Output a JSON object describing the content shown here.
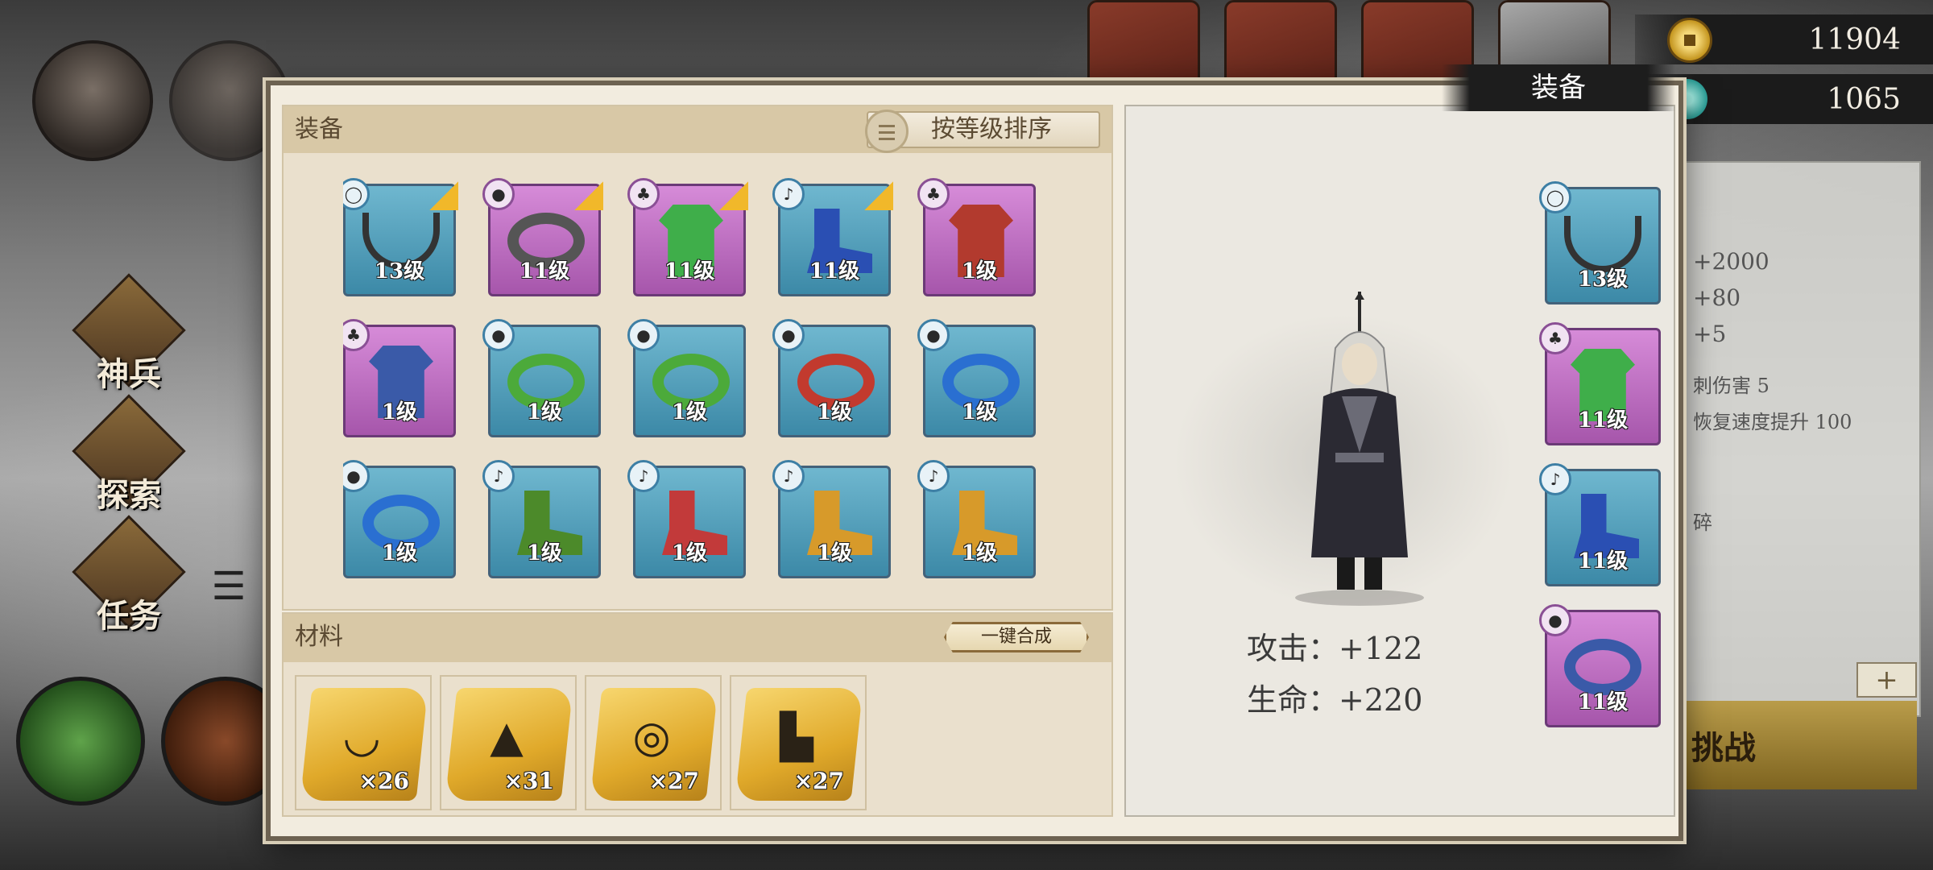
{
  "currency": {
    "coins": "11904",
    "gems": "1065"
  },
  "side_menu": [
    {
      "label": "神兵"
    },
    {
      "label": "探索"
    },
    {
      "label": "任务"
    }
  ],
  "bg_panel": {
    "lines": [
      "+2000",
      "+80",
      "+5",
      "刺伤害 5",
      "恢复速度提升 100",
      "碎"
    ]
  },
  "bg_challenge_label": "挑战",
  "bg_plus_label": "+",
  "dialog": {
    "tab_title": "装备",
    "equip_header": "装备",
    "sort_label": "按等级排序",
    "materials_header": "材料",
    "merge_label": "一键合成"
  },
  "grid_items": [
    {
      "type": "necklace",
      "level": "13级",
      "rarity": "blue",
      "badge": "necklace-icon",
      "new": true
    },
    {
      "type": "ring",
      "level": "11级",
      "rarity": "purple",
      "badge": "ring-icon",
      "new": true
    },
    {
      "type": "robe",
      "level": "11级",
      "rarity": "purple",
      "badge": "robe-icon",
      "new": true,
      "color": "#3fae4a"
    },
    {
      "type": "boots",
      "level": "11级",
      "rarity": "blue",
      "badge": "boots-icon",
      "new": true,
      "color": "#2a4fb3"
    },
    {
      "type": "robe",
      "level": "1级",
      "rarity": "purple",
      "badge": "robe-icon",
      "new": false,
      "color": "#b23a2e"
    },
    {
      "type": "robe",
      "level": "1级",
      "rarity": "purple",
      "badge": "robe-icon",
      "new": false,
      "color": "#3a5aa8"
    },
    {
      "type": "ring",
      "level": "1级",
      "rarity": "blue",
      "badge": "ring-icon",
      "new": false,
      "color": "#4caa3a"
    },
    {
      "type": "ring",
      "level": "1级",
      "rarity": "blue",
      "badge": "ring-icon",
      "new": false,
      "color": "#4caa3a"
    },
    {
      "type": "ring",
      "level": "1级",
      "rarity": "blue",
      "badge": "ring-icon",
      "new": false,
      "color": "#c23a2e"
    },
    {
      "type": "ring",
      "level": "1级",
      "rarity": "blue",
      "badge": "ring-icon",
      "new": false,
      "color": "#2a6fd1"
    },
    {
      "type": "ring",
      "level": "1级",
      "rarity": "blue",
      "badge": "ring-icon",
      "new": false,
      "color": "#2a6fd1"
    },
    {
      "type": "boots",
      "level": "1级",
      "rarity": "blue",
      "badge": "boots-icon",
      "new": false,
      "color": "#4c8a2a"
    },
    {
      "type": "boots",
      "level": "1级",
      "rarity": "blue",
      "badge": "boots-icon",
      "new": false,
      "color": "#c23a3a"
    },
    {
      "type": "boots",
      "level": "1级",
      "rarity": "blue",
      "badge": "boots-icon",
      "new": false,
      "color": "#d79a2a"
    },
    {
      "type": "boots",
      "level": "1级",
      "rarity": "blue",
      "badge": "boots-icon",
      "new": false,
      "color": "#d79a2a"
    },
    {
      "type": "necklace",
      "level": "",
      "rarity": "blue",
      "badge": "necklace-icon",
      "new": false
    },
    {
      "type": "boots",
      "level": "",
      "rarity": "blue",
      "badge": "boots-icon",
      "new": false
    },
    {
      "type": "boots",
      "level": "",
      "rarity": "blue",
      "badge": "boots-icon",
      "new": false
    },
    {
      "type": "necklace",
      "level": "",
      "rarity": "blue",
      "badge": "necklace-icon",
      "new": false
    },
    {
      "type": "ring",
      "level": "",
      "rarity": "blue",
      "badge": "ring-icon",
      "new": false
    }
  ],
  "materials": [
    {
      "icon": "necklace-scroll-icon",
      "qty": "×26"
    },
    {
      "icon": "robe-scroll-icon",
      "qty": "×31"
    },
    {
      "icon": "ring-scroll-icon",
      "qty": "×27"
    },
    {
      "icon": "boots-scroll-icon",
      "qty": "×27"
    }
  ],
  "character": {
    "attack": "攻击：+122",
    "hp": "生命：+220"
  },
  "equipped": [
    {
      "type": "necklace",
      "level": "13级",
      "rarity": "blue",
      "badge": "necklace-icon"
    },
    {
      "type": "robe",
      "level": "11级",
      "rarity": "purple",
      "badge": "robe-icon",
      "color": "#3fae4a"
    },
    {
      "type": "boots",
      "level": "11级",
      "rarity": "blue",
      "badge": "boots-icon",
      "color": "#2a4fb3"
    },
    {
      "type": "ring",
      "level": "11级",
      "rarity": "purple",
      "badge": "ring-icon",
      "color": "#3a5aa8"
    }
  ],
  "colors": {
    "rarity_blue": "#5aa6c2",
    "rarity_purple": "#c47ac8",
    "new_corner": "#f1b82a",
    "dialog_bg": "#f2ecdf"
  }
}
